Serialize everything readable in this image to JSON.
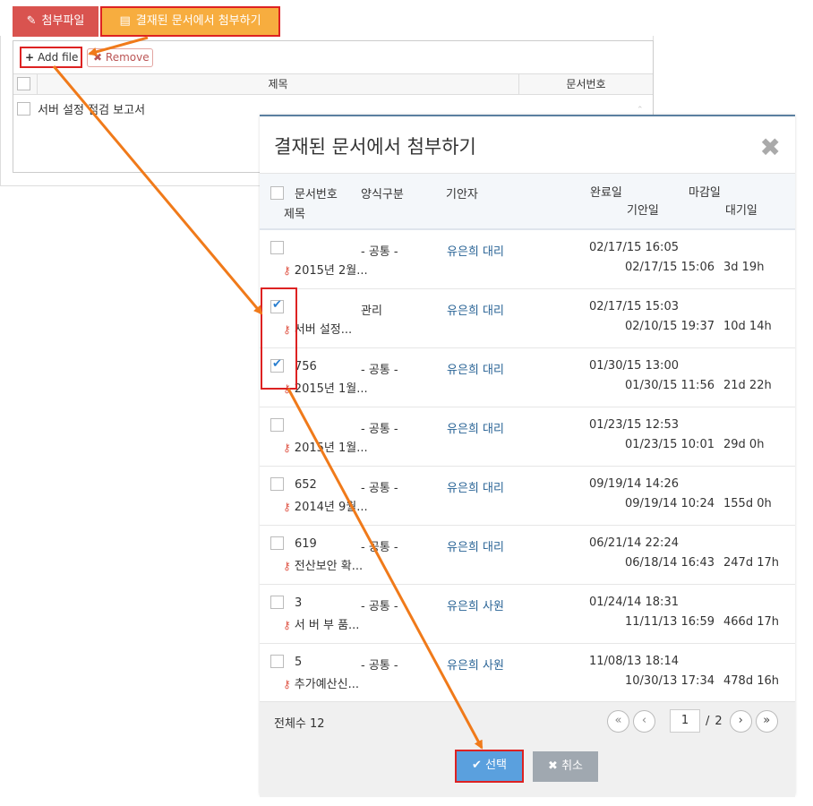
{
  "attach": {
    "tab_file": "첨부파일",
    "tab_doc": "결재된 문서에서 첨부하기",
    "add_file": "Add file",
    "remove": "Remove",
    "col_title": "제목",
    "col_docnum": "문서번호",
    "file_row": "서버 설정 점검 보고서"
  },
  "modal": {
    "title": "결재된 문서에서 첨부하기",
    "headers": {
      "docnum": "문서번호",
      "form": "양식구분",
      "author": "기안자",
      "done": "완료일",
      "deadline": "마감일",
      "title": "제목",
      "draft": "기안일",
      "wait": "대기일"
    },
    "rows": [
      {
        "checked": false,
        "num": "",
        "form": "- 공통 -",
        "author": "유은희 대리",
        "done": "02/17/15 16:05",
        "draft": "02/17/15 15:06",
        "wait": "3d 19h",
        "title": "2015년 2월..."
      },
      {
        "checked": true,
        "num": "",
        "form": "관리",
        "author": "유은희 대리",
        "done": "02/17/15 15:03",
        "draft": "02/10/15 19:37",
        "wait": "10d 14h",
        "title": "서버 설정..."
      },
      {
        "checked": true,
        "num": "756",
        "form": "- 공통 -",
        "author": "유은희 대리",
        "done": "01/30/15 13:00",
        "draft": "01/30/15 11:56",
        "wait": "21d 22h",
        "title": "2015년 1월..."
      },
      {
        "checked": false,
        "num": "",
        "form": "- 공통 -",
        "author": "유은희 대리",
        "done": "01/23/15 12:53",
        "draft": "01/23/15 10:01",
        "wait": "29d 0h",
        "title": "2015년 1월..."
      },
      {
        "checked": false,
        "num": "652",
        "form": "- 공통 -",
        "author": "유은희 대리",
        "done": "09/19/14 14:26",
        "draft": "09/19/14 10:24",
        "wait": "155d 0h",
        "title": "2014년 9월..."
      },
      {
        "checked": false,
        "num": "619",
        "form": "- 공통 -",
        "author": "유은희 대리",
        "done": "06/21/14 22:24",
        "draft": "06/18/14 16:43",
        "wait": "247d 17h",
        "title": "전산보안 확..."
      },
      {
        "checked": false,
        "num": "3",
        "form": "- 공통 -",
        "author": "유은희 사원",
        "done": "01/24/14 18:31",
        "draft": "11/11/13 16:59",
        "wait": "466d 17h",
        "title": "서 버 부 품..."
      },
      {
        "checked": false,
        "num": "5",
        "form": "- 공통 -",
        "author": "유은희 사원",
        "done": "11/08/13 18:14",
        "draft": "10/30/13 17:34",
        "wait": "478d 16h",
        "title": "추가예산신..."
      }
    ],
    "total_label": "전체수 12",
    "page_current": "1",
    "page_sep": "/",
    "page_total": "2",
    "ok": "선택",
    "cancel": "취소"
  },
  "colors": {
    "accent_orange": "#f07a1a",
    "highlight_red": "#dd2222",
    "tab_red": "#d9534f",
    "tab_orange": "#f7ad3f",
    "link_blue": "#2a6496",
    "ok_blue": "#5aa0de"
  },
  "icons": {
    "tab_file": "paperclip-icon",
    "tab_doc": "document-icon",
    "add": "plus-icon",
    "remove": "x-icon",
    "close": "close-icon",
    "row_key": "key-icon"
  }
}
